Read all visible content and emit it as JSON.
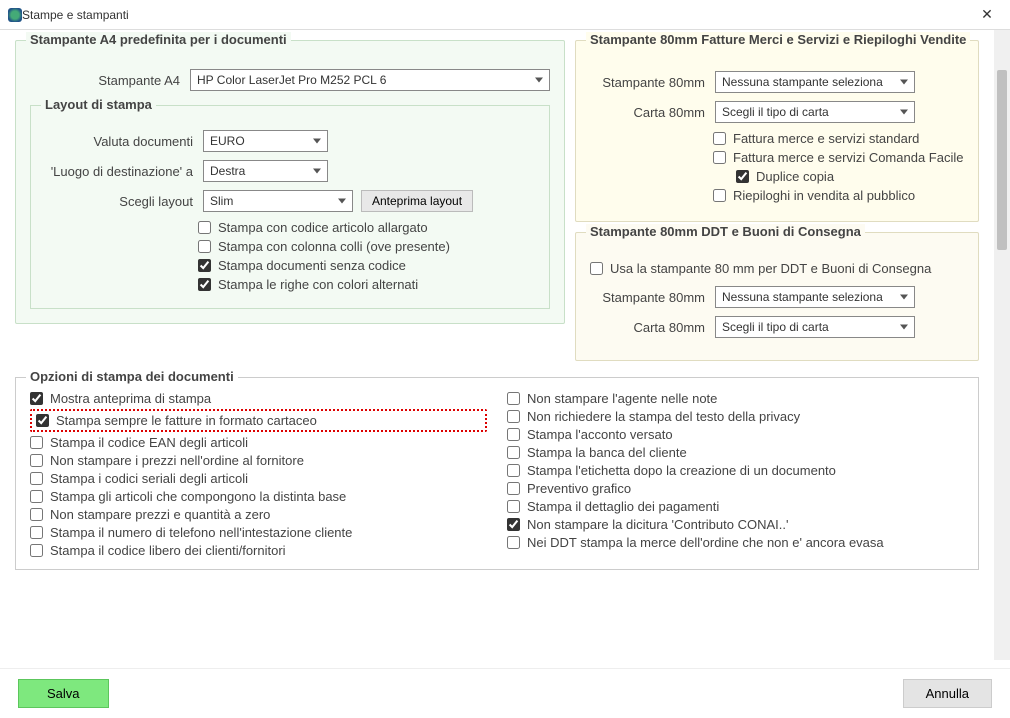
{
  "window": {
    "title": "Stampe e stampanti"
  },
  "a4": {
    "legend": "Stampante A4 predefinita per i documenti",
    "printer_label": "Stampante A4",
    "printer_value": "HP Color LaserJet Pro M252 PCL 6",
    "layout_legend": "Layout di stampa",
    "currency_label": "Valuta documenti",
    "currency_value": "EURO",
    "dest_label": "'Luogo di destinazione' a",
    "dest_value": "Destra",
    "layout_label": "Scegli layout",
    "layout_value": "Slim",
    "preview_btn": "Anteprima layout",
    "chk_large_code": "Stampa con codice articolo allargato",
    "chk_colli": "Stampa con colonna colli (ove presente)",
    "chk_nocode": "Stampa documenti senza codice",
    "chk_altrows": "Stampa le righe con colori alternati"
  },
  "p80a": {
    "legend": "Stampante 80mm Fatture Merci e Servizi e Riepiloghi Vendite",
    "printer_label": "Stampante 80mm",
    "printer_value": "Nessuna stampante seleziona",
    "paper_label": "Carta 80mm",
    "paper_value": "Scegli il tipo di carta",
    "chk_std": "Fattura merce e servizi standard",
    "chk_comanda": "Fattura merce e servizi Comanda Facile",
    "chk_dup": "Duplice copia",
    "chk_riep": "Riepiloghi in vendita al pubblico"
  },
  "p80b": {
    "legend": "Stampante 80mm DDT e Buoni di Consegna",
    "chk_use": "Usa la stampante 80 mm per DDT e Buoni di Consegna",
    "printer_label": "Stampante 80mm",
    "printer_value": "Nessuna stampante seleziona",
    "paper_label": "Carta 80mm",
    "paper_value": "Scegli il tipo di carta"
  },
  "opts": {
    "legend": "Opzioni di stampa dei documenti",
    "left": [
      {
        "label": "Mostra anteprima di stampa",
        "checked": true,
        "hl": false
      },
      {
        "label": "Stampa sempre le fatture in formato cartaceo",
        "checked": true,
        "hl": true
      },
      {
        "label": "Stampa il codice EAN degli articoli",
        "checked": false,
        "hl": false
      },
      {
        "label": "Non stampare i prezzi nell'ordine al fornitore",
        "checked": false,
        "hl": false
      },
      {
        "label": "Stampa i codici seriali degli articoli",
        "checked": false,
        "hl": false
      },
      {
        "label": "Stampa gli articoli che compongono la distinta base",
        "checked": false,
        "hl": false
      },
      {
        "label": "Non stampare prezzi e quantità a zero",
        "checked": false,
        "hl": false
      },
      {
        "label": "Stampa il numero di telefono nell'intestazione cliente",
        "checked": false,
        "hl": false
      },
      {
        "label": "Stampa il codice libero dei clienti/fornitori",
        "checked": false,
        "hl": false
      }
    ],
    "right": [
      {
        "label": "Non stampare l'agente nelle note",
        "checked": false
      },
      {
        "label": "Non richiedere la stampa del testo della privacy",
        "checked": false
      },
      {
        "label": "Stampa l'acconto versato",
        "checked": false
      },
      {
        "label": "Stampa la banca del cliente",
        "checked": false
      },
      {
        "label": "Stampa l'etichetta dopo la creazione di un documento",
        "checked": false
      },
      {
        "label": "Preventivo grafico",
        "checked": false
      },
      {
        "label": "Stampa il dettaglio dei pagamenti",
        "checked": false
      },
      {
        "label": "Non stampare la dicitura 'Contributo CONAI..'",
        "checked": true
      },
      {
        "label": "Nei DDT stampa la merce dell'ordine che non e' ancora evasa",
        "checked": false
      }
    ]
  },
  "footer": {
    "save": "Salva",
    "cancel": "Annulla"
  }
}
